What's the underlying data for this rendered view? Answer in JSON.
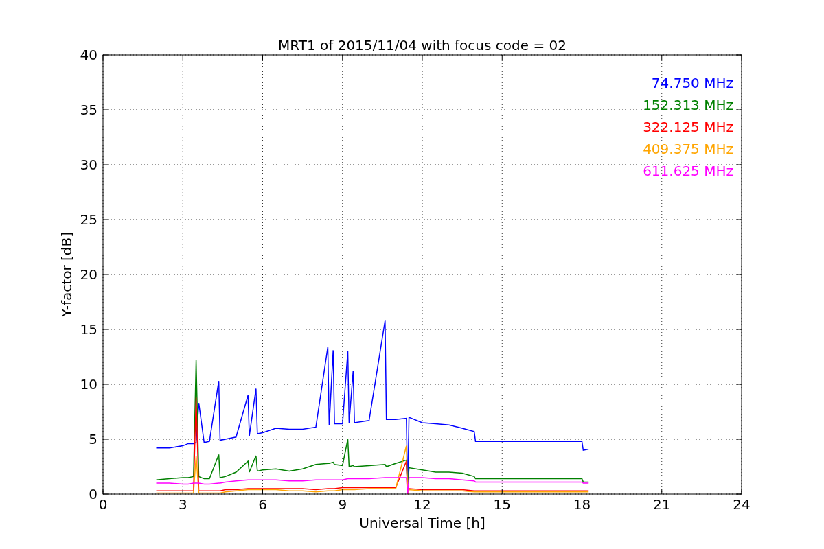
{
  "chart_data": {
    "type": "line",
    "title": "MRT1 of 2015/11/04 with focus code = 02",
    "xlabel": "Universal Time [h]",
    "ylabel": "Y-factor [dB]",
    "xlim": [
      0,
      24
    ],
    "ylim": [
      0,
      40
    ],
    "grid": true,
    "xticks": [
      0,
      3,
      6,
      9,
      12,
      15,
      18,
      21,
      24
    ],
    "yticks": [
      0,
      5,
      10,
      15,
      20,
      25,
      30,
      35,
      40
    ],
    "x": [
      2,
      2.5,
      3,
      3.2,
      3.4,
      3.5,
      3.6,
      3.8,
      4,
      4.35,
      4.4,
      4.6,
      5,
      5.45,
      5.5,
      5.75,
      5.8,
      6,
      6.5,
      7,
      7.5,
      8,
      8.45,
      8.5,
      8.65,
      8.7,
      9,
      9.2,
      9.25,
      9.4,
      9.45,
      10,
      10.6,
      10.65,
      11,
      11.4,
      11.45,
      11.5,
      12,
      12.5,
      13,
      13.5,
      13.95,
      14,
      18,
      18.05,
      18.25
    ],
    "series": [
      {
        "name": "74.750 MHz",
        "color": "#0000ff",
        "values": [
          4.2,
          4.2,
          4.4,
          4.6,
          4.6,
          4.7,
          8.3,
          4.7,
          4.8,
          10.3,
          4.9,
          5.0,
          5.2,
          9.0,
          5.3,
          9.6,
          5.5,
          5.6,
          6.0,
          5.9,
          5.9,
          6.1,
          13.4,
          6.3,
          13.1,
          6.4,
          6.4,
          13.0,
          6.5,
          11.2,
          6.5,
          6.7,
          15.8,
          6.8,
          6.8,
          6.9,
          0.0,
          7.0,
          6.5,
          6.4,
          6.3,
          6.0,
          5.7,
          4.8,
          4.8,
          4.0,
          4.1
        ]
      },
      {
        "name": "152.313 MHz",
        "color": "#008000",
        "values": [
          1.3,
          1.4,
          1.5,
          1.5,
          1.6,
          12.2,
          1.6,
          1.4,
          1.4,
          3.6,
          1.5,
          1.6,
          2.0,
          3.0,
          2.0,
          3.5,
          2.1,
          2.2,
          2.3,
          2.1,
          2.3,
          2.7,
          2.8,
          2.8,
          2.9,
          2.7,
          2.6,
          5.0,
          2.5,
          2.6,
          2.5,
          2.6,
          2.7,
          2.5,
          2.8,
          3.1,
          0.0,
          2.4,
          2.2,
          2.0,
          2.0,
          1.9,
          1.6,
          1.4,
          1.4,
          1.1,
          1.1
        ]
      },
      {
        "name": "322.125 MHz",
        "color": "#ff0000",
        "values": [
          0.3,
          0.3,
          0.3,
          0.3,
          0.3,
          8.8,
          0.3,
          0.3,
          0.3,
          0.3,
          0.3,
          0.4,
          0.4,
          0.5,
          0.5,
          0.5,
          0.5,
          0.5,
          0.5,
          0.5,
          0.5,
          0.4,
          0.5,
          0.5,
          0.5,
          0.5,
          0.6,
          0.6,
          0.6,
          0.6,
          0.6,
          0.6,
          0.6,
          0.6,
          0.6,
          3.0,
          0.0,
          0.5,
          0.4,
          0.4,
          0.4,
          0.4,
          0.3,
          0.3,
          0.3,
          0.3,
          0.3
        ]
      },
      {
        "name": "409.375 MHz",
        "color": "#ffa500",
        "values": [
          0.1,
          0.1,
          0.1,
          0.1,
          0.1,
          3.5,
          0.1,
          0.1,
          0.1,
          0.1,
          0.1,
          0.2,
          0.3,
          0.4,
          0.4,
          0.4,
          0.4,
          0.4,
          0.4,
          0.3,
          0.3,
          0.2,
          0.3,
          0.3,
          0.3,
          0.3,
          0.4,
          0.4,
          0.4,
          0.4,
          0.4,
          0.5,
          0.5,
          0.5,
          0.5,
          4.4,
          0.0,
          0.4,
          0.3,
          0.3,
          0.3,
          0.3,
          0.2,
          0.2,
          0.2,
          0.2,
          0.2
        ]
      },
      {
        "name": "611.625 MHz",
        "color": "#ff00ff",
        "values": [
          1.0,
          1.0,
          0.9,
          0.9,
          1.0,
          1.0,
          1.0,
          0.9,
          0.9,
          1.0,
          1.0,
          1.1,
          1.2,
          1.3,
          1.3,
          1.3,
          1.3,
          1.3,
          1.3,
          1.2,
          1.2,
          1.3,
          1.3,
          1.3,
          1.3,
          1.3,
          1.3,
          1.4,
          1.4,
          1.4,
          1.4,
          1.4,
          1.5,
          1.5,
          1.5,
          1.5,
          0.0,
          1.5,
          1.5,
          1.4,
          1.4,
          1.3,
          1.2,
          1.1,
          1.1,
          1.0,
          1.0
        ]
      }
    ]
  }
}
